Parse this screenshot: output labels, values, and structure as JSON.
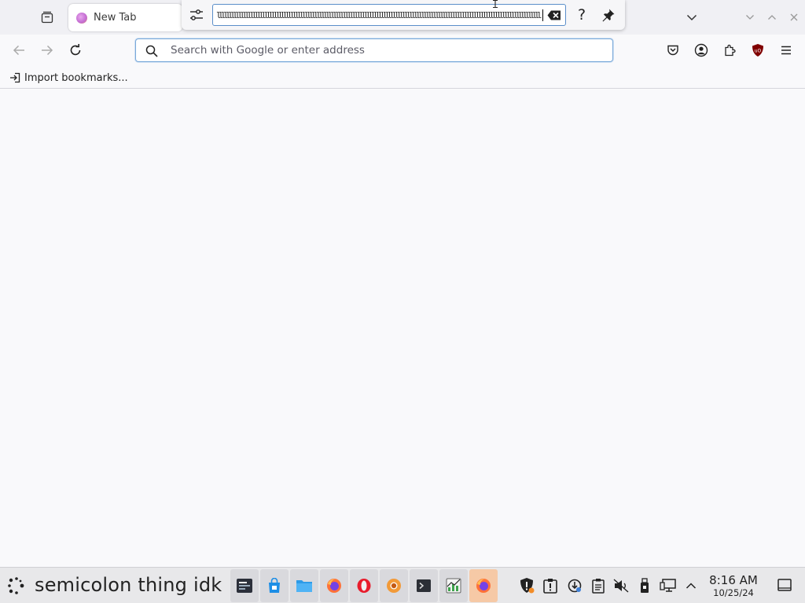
{
  "tab": {
    "title": "New Tab"
  },
  "findbar": {
    "query": "llllllllllllllllllllllllllllllllllllllllllllllllllllllllllllllllllllllllllllllllllllllllllllllllllllllllllllllllllllllllllllllllllllllll",
    "help": "?"
  },
  "urlbar": {
    "placeholder": "Search with Google or enter address"
  },
  "bookmarks": {
    "import_label": "Import bookmarks..."
  },
  "taskbar": {
    "start_label": "semicolon thing idk",
    "apps": [
      "app-launcher-icon",
      "software-center-icon",
      "file-manager-icon",
      "firefox-icon",
      "opera-icon",
      "chromium-icon",
      "terminal-icon",
      "system-monitor-icon",
      "firefox-icon"
    ],
    "clock_time": "8:16 AM",
    "clock_date": "10/25/24"
  },
  "colors": {
    "accent": "#0061e0",
    "urlbar_border": "#7aa9d9",
    "active_task": "#f6c9a6",
    "opera_red": "#e81c2c",
    "ublock_red": "#800000"
  }
}
